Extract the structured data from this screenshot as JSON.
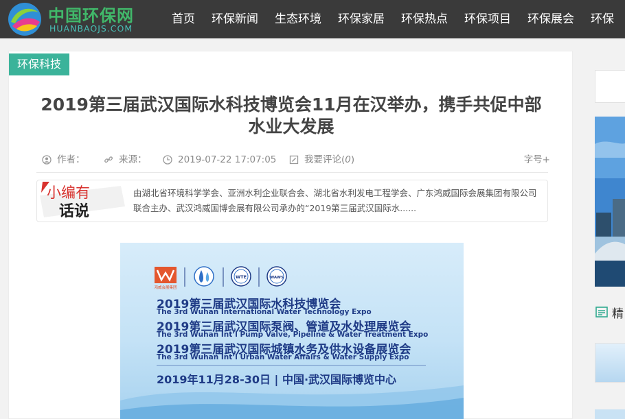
{
  "header": {
    "logo_name": "中国环保网",
    "logo_domain": "HUANBAOJS.COM",
    "nav": [
      "首页",
      "环保新闻",
      "生态环境",
      "环保家居",
      "环保热点",
      "环保项目",
      "环保展会",
      "环保"
    ]
  },
  "article": {
    "category": "环保科技",
    "title": "2019第三届武汉国际水科技博览会11月在汉举办，携手共促中部水业大发展",
    "meta": {
      "author_label": "作者：",
      "source_label": "来源：",
      "datetime": "2019-07-22 17:07:05",
      "comment_label": "我要评论(",
      "comment_count": "0",
      "comment_close": ")",
      "font_size_label": "字号+"
    },
    "summary": {
      "badge_line1": "小编有",
      "badge_line2": "话说",
      "text": "由湖北省环境科学学会、亚洲水利企业联合会、湖北省水利发电工程学会、广东鸿威国际会展集团有限公司联合主办、武汉鸿威国博会展有限公司承办的“2019第三届武汉国际水......"
    },
    "poster": {
      "logo_caption": "鸿威会展集团",
      "logo_badges": [
        "WTE",
        "WAWS"
      ],
      "lines": [
        {
          "cn": "2019第三届武汉国际水科技博览会",
          "en": "The 3rd Wuhan International Water Technology Expo"
        },
        {
          "cn": "2019第三届武汉国际泵阀、管道及水处理展览会",
          "en": "The 3rd Wuhan Int’l Pump Valve, Pipeline & Water Treatment Expo"
        },
        {
          "cn": "2019第三届武汉国际城镇水务及供水设备展览会",
          "en": "The 3rd Wuhan Int’l Urban Water Affairs & Water Supply Expo"
        }
      ],
      "date_venue": "2019年11月28-30日  |  中国·武汉国际博览中心"
    }
  },
  "sidebar": {
    "section_title": "精"
  },
  "colors": {
    "header_bg": "#3a3a3a",
    "accent_green": "#3bb39a",
    "poster_text": "#1f3b86",
    "badge_red": "#d8322e"
  }
}
